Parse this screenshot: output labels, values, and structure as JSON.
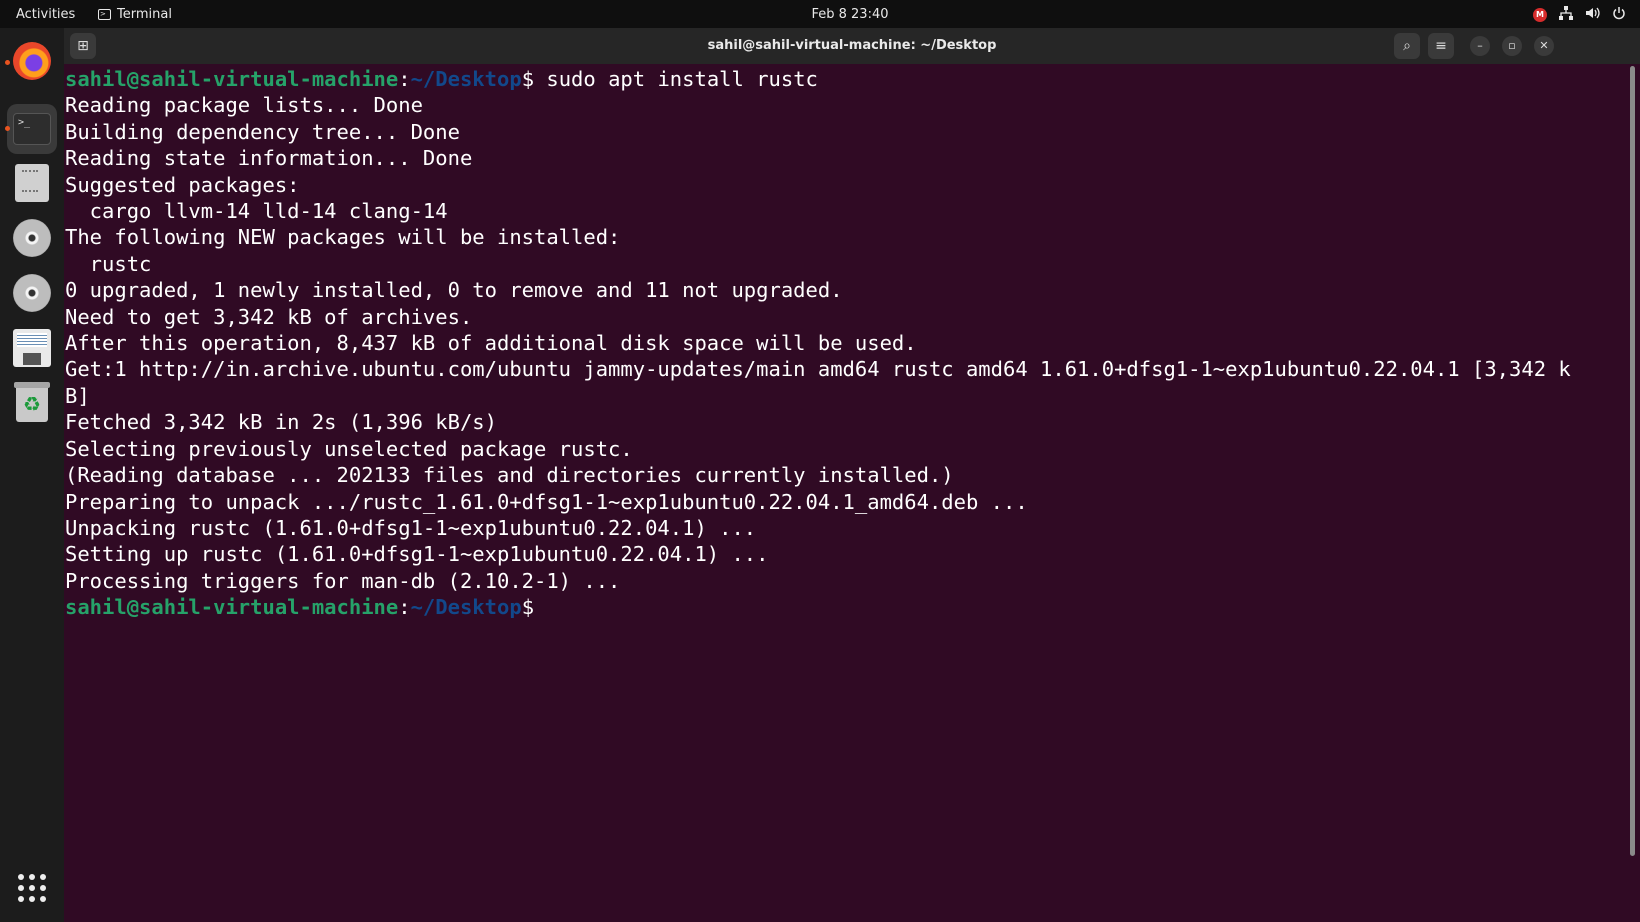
{
  "topbar": {
    "activities": "Activities",
    "app_name": "Terminal",
    "clock": "Feb 8  23:40",
    "rec_label": "M"
  },
  "dock": {
    "items": [
      "firefox-icon",
      "terminal-icon",
      "files-icon",
      "disc-icon",
      "disc-icon",
      "floppy-icon",
      "trash-icon"
    ],
    "terminal_glyph": ">_"
  },
  "window": {
    "title": "sahil@sahil-virtual-machine: ~/Desktop",
    "buttons": {
      "new_tab": "⊞",
      "search": "⌕",
      "menu": "≡",
      "minimize": "–",
      "maximize": "▫",
      "close": "✕"
    }
  },
  "terminal": {
    "prompt_user": "sahil@sahil-virtual-machine",
    "prompt_sep": ":",
    "prompt_path": "~/Desktop",
    "prompt_symbol": "$",
    "command": " sudo apt install rustc",
    "output": [
      "Reading package lists... Done",
      "Building dependency tree... Done",
      "Reading state information... Done",
      "Suggested packages:",
      "  cargo llvm-14 lld-14 clang-14",
      "The following NEW packages will be installed:",
      "  rustc",
      "0 upgraded, 1 newly installed, 0 to remove and 11 not upgraded.",
      "Need to get 3,342 kB of archives.",
      "After this operation, 8,437 kB of additional disk space will be used.",
      "Get:1 http://in.archive.ubuntu.com/ubuntu jammy-updates/main amd64 rustc amd64 1.61.0+dfsg1-1~exp1ubuntu0.22.04.1 [3,342 k",
      "B]",
      "Fetched 3,342 kB in 2s (1,396 kB/s)",
      "Selecting previously unselected package rustc.",
      "(Reading database ... 202133 files and directories currently installed.)",
      "Preparing to unpack .../rustc_1.61.0+dfsg1-1~exp1ubuntu0.22.04.1_amd64.deb ...",
      "Unpacking rustc (1.61.0+dfsg1-1~exp1ubuntu0.22.04.1) ...",
      "Setting up rustc (1.61.0+dfsg1-1~exp1ubuntu0.22.04.1) ...",
      "Processing triggers for man-db (2.10.2-1) ..."
    ]
  }
}
